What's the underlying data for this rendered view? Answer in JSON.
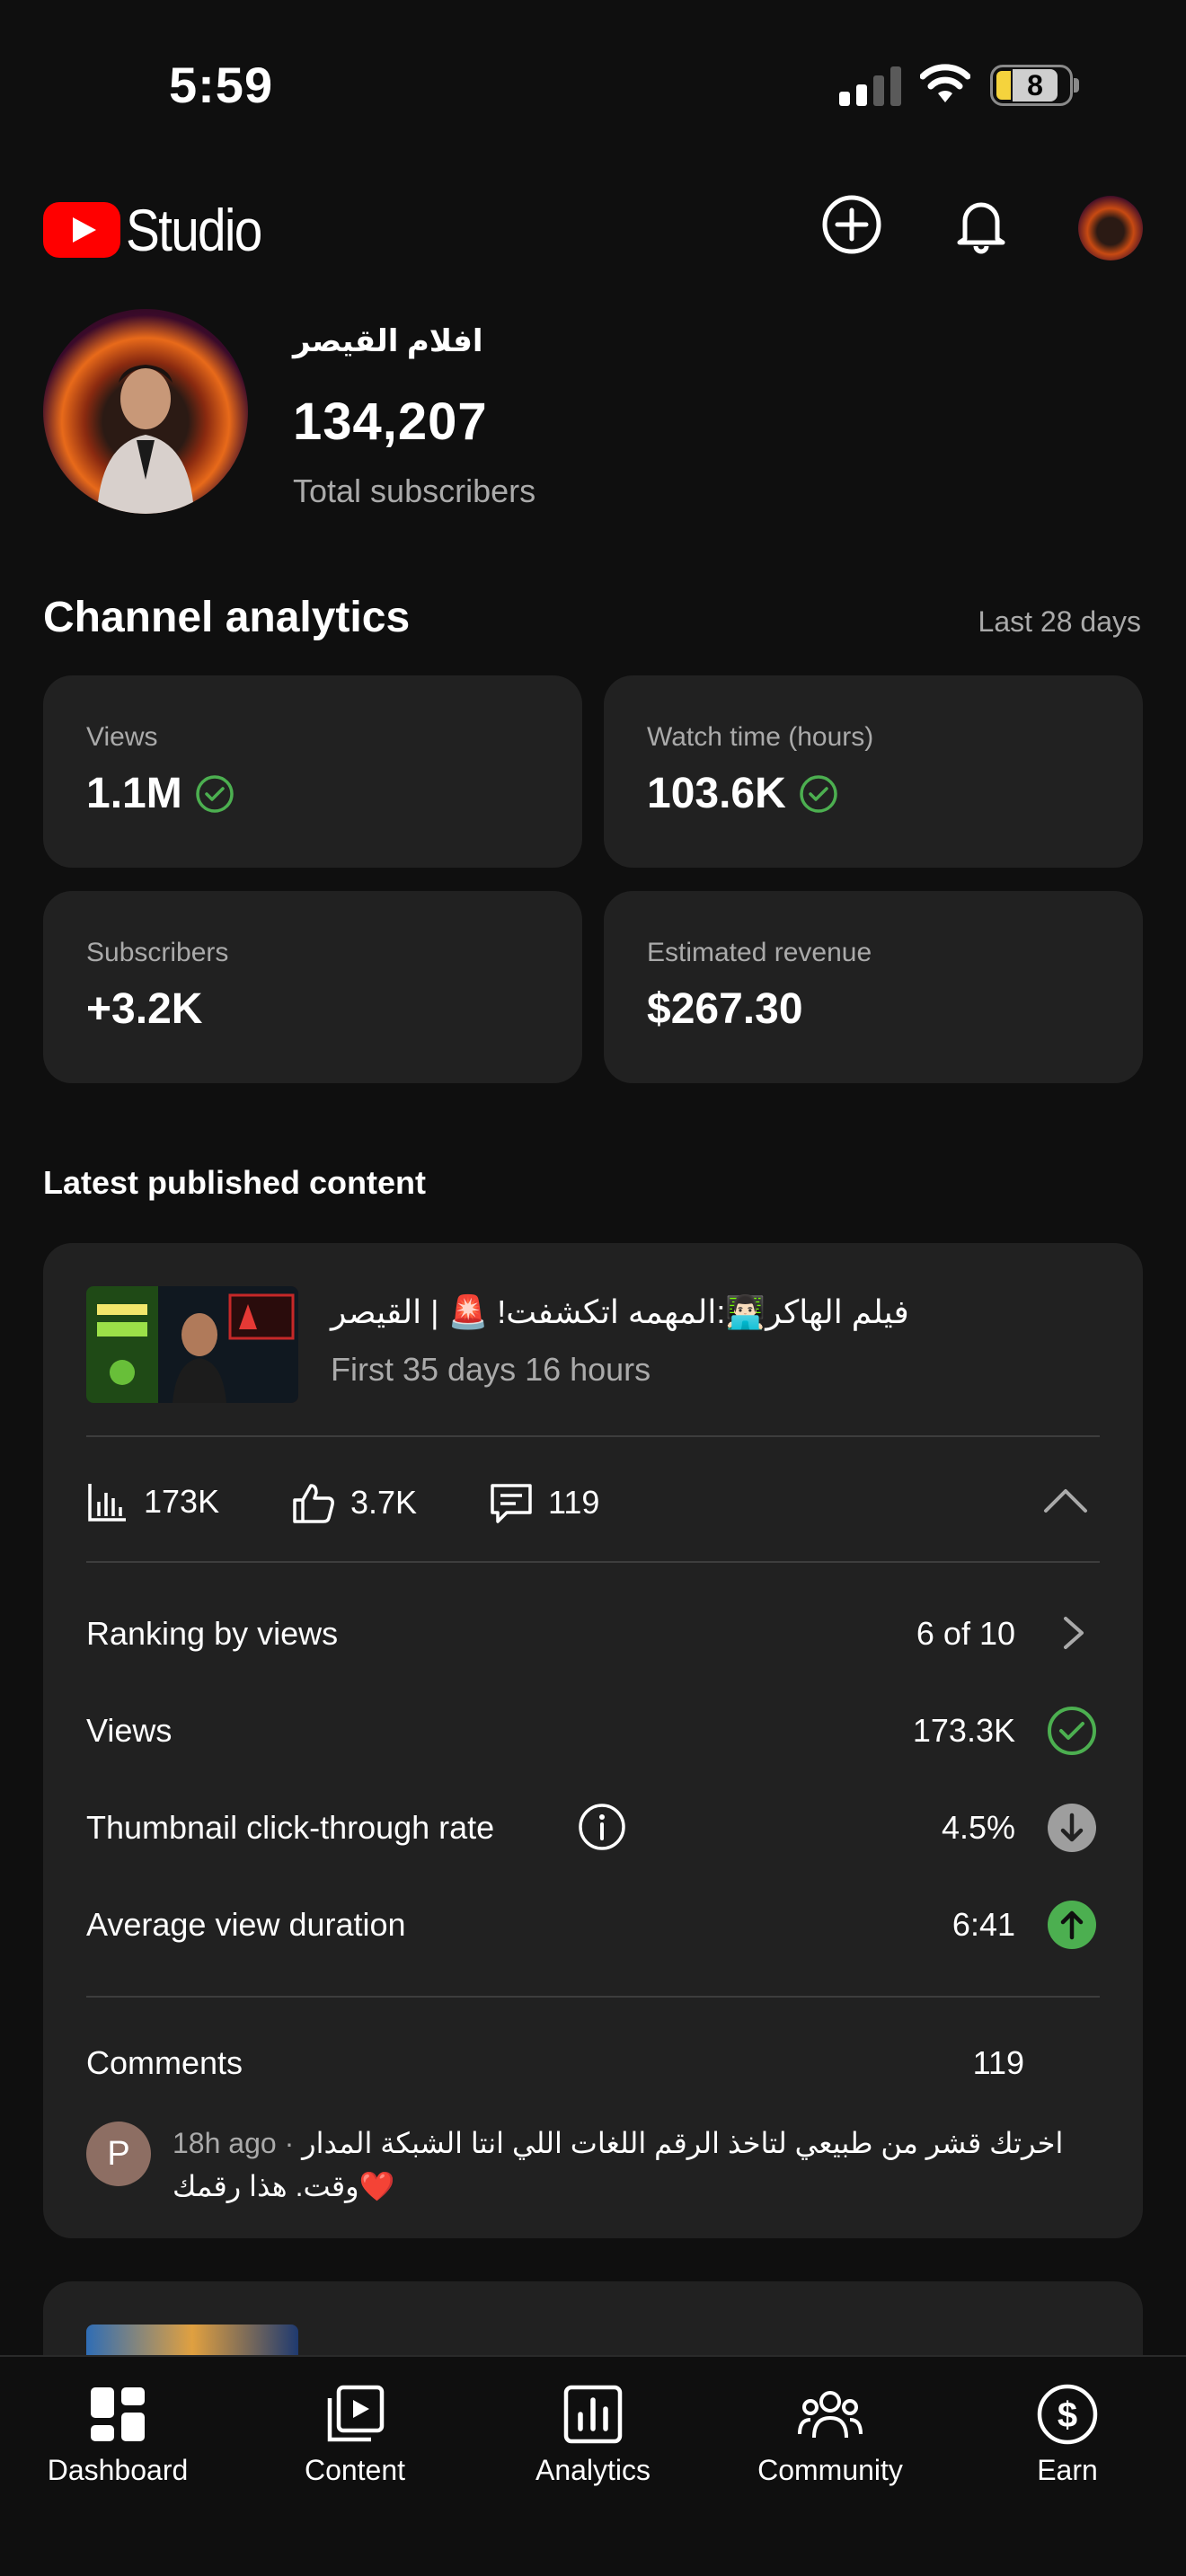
{
  "status_bar": {
    "time": "5:59",
    "battery": "8"
  },
  "header": {
    "brand": "Studio"
  },
  "channel": {
    "name": "افلام القيصر",
    "subscribers": "134,207",
    "subscribers_label": "Total subscribers"
  },
  "analytics": {
    "title": "Channel analytics",
    "period": "Last 28 days",
    "stats": [
      {
        "label": "Views",
        "value": "1.1M"
      },
      {
        "label": "Watch time (hours)",
        "value": "103.6K"
      },
      {
        "label": "Subscribers",
        "value": "+3.2K"
      },
      {
        "label": "Estimated revenue",
        "value": "$267.30"
      }
    ]
  },
  "latest": {
    "title": "Latest published content",
    "video": {
      "title": "فيلم الهاكر👨🏻‍💻:المهمه اتكشفت! 🚨 | القيصر",
      "subtitle": "First 35 days 16 hours",
      "views_short": "173K",
      "likes": "3.7K",
      "comments_count": "119",
      "rows": [
        {
          "label": "Ranking by views",
          "value": "6 of 10"
        },
        {
          "label": "Views",
          "value": "173.3K"
        },
        {
          "label": "Thumbnail click-through rate",
          "value": "4.5%"
        },
        {
          "label": "Average view duration",
          "value": "6:41"
        }
      ],
      "comments_label": "Comments",
      "comments_total": "119",
      "comment": {
        "avatar_letter": "P",
        "time": "18h ago",
        "text": "اخرتك قشر من طبيعي لتاخذ الرقم اللغات اللي انتا الشبكة المدار وقت. هذا رقمك❤️"
      }
    }
  },
  "nav": [
    {
      "label": "Dashboard",
      "icon": "dashboard-icon"
    },
    {
      "label": "Content",
      "icon": "content-icon"
    },
    {
      "label": "Analytics",
      "icon": "analytics-icon"
    },
    {
      "label": "Community",
      "icon": "community-icon"
    },
    {
      "label": "Earn",
      "icon": "earn-icon"
    }
  ],
  "colors": {
    "accent_red": "#ff0000",
    "positive_green": "#4caf50",
    "background": "#0f0f0f",
    "card": "#212121"
  }
}
